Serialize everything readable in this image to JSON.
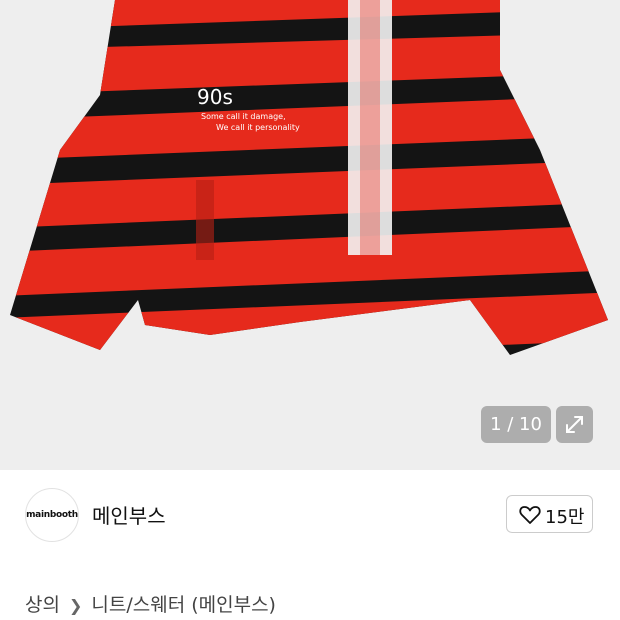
{
  "gallery": {
    "image_subject": "red-black-striped-knit-sweater",
    "counter": "1 / 10",
    "print_text": {
      "label_90s": "90s",
      "line1": "Some call it damage,",
      "line2": "We call it personality"
    },
    "expand_icon": "expand-arrows-icon"
  },
  "seller": {
    "avatar_text": "mainbooth",
    "name": "메인부스",
    "likes_icon": "heart-outline-icon",
    "likes": "15만"
  },
  "breadcrumb": {
    "category": "상의",
    "separator_icon": "chevron-right-icon",
    "subcategory": "니트/스웨터 (메인부스)"
  },
  "colors": {
    "stripe_red": "#e62a1c",
    "stripe_black": "#141414",
    "background": "#eeeeee"
  }
}
